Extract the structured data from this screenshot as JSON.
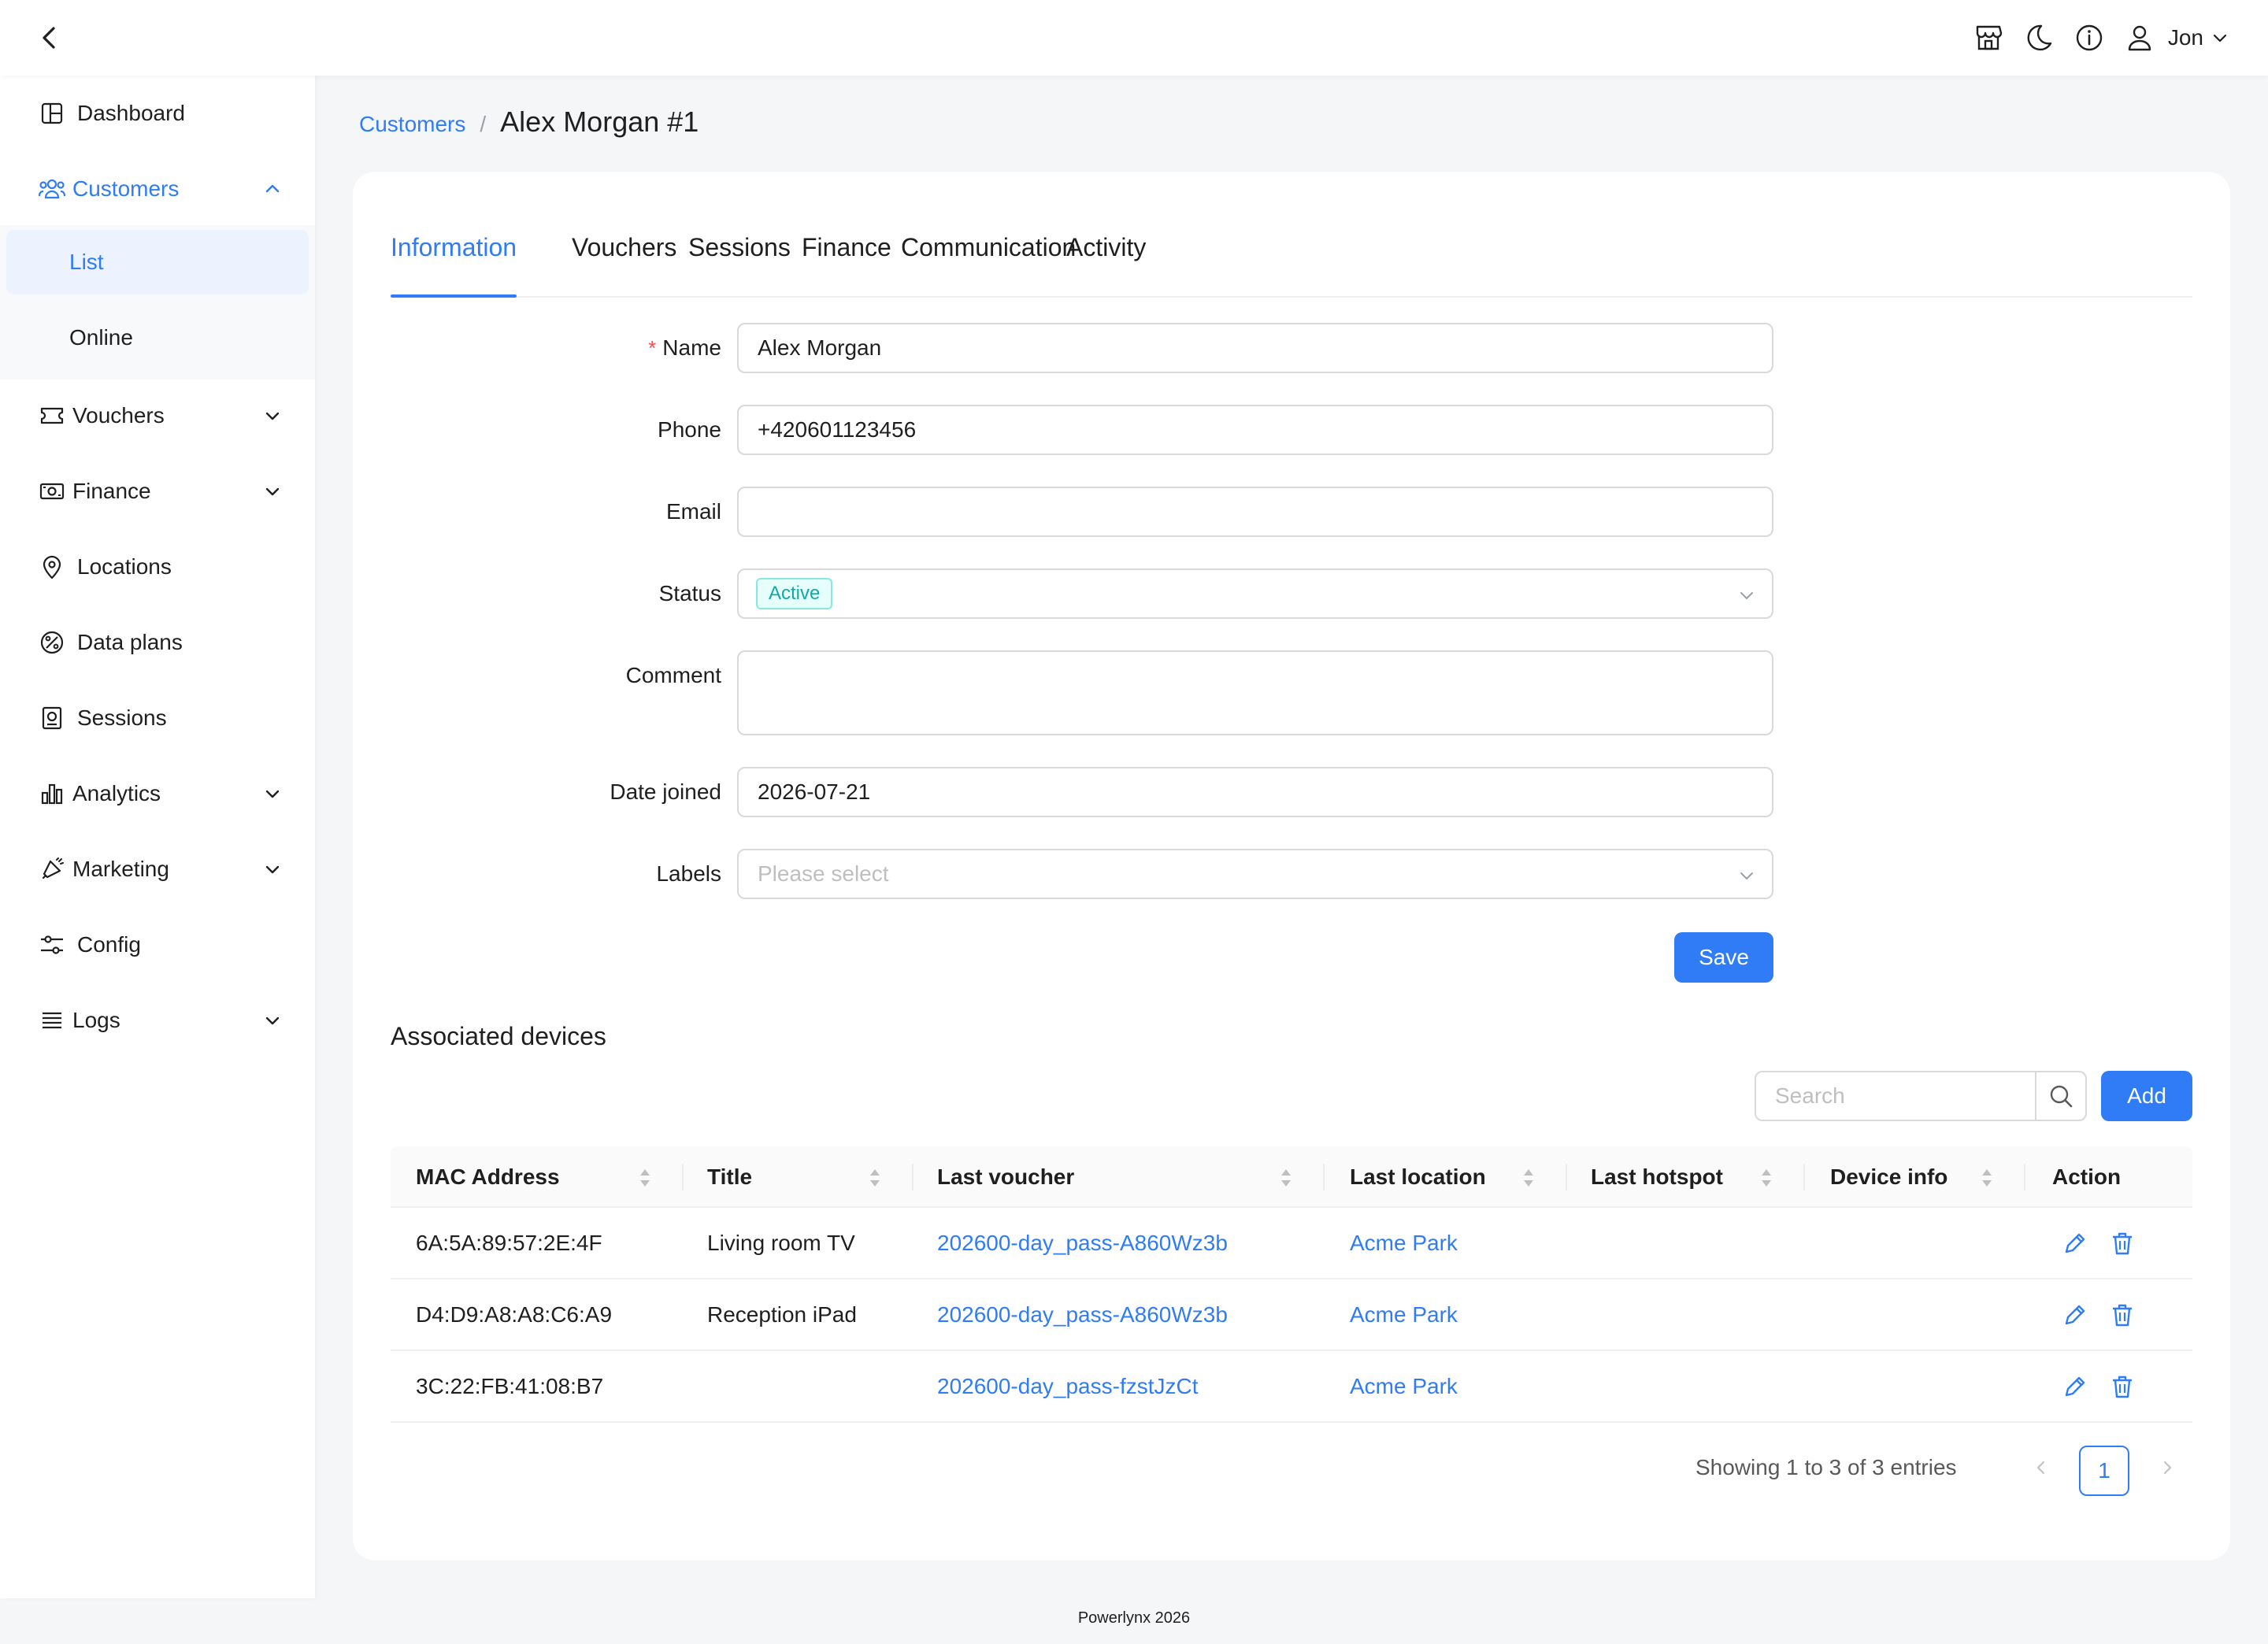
{
  "header": {
    "user_name": "Jon",
    "icons": [
      "back-icon",
      "store-icon",
      "moon-icon",
      "info-icon",
      "user-icon",
      "chevron-down-icon"
    ]
  },
  "sidebar": {
    "items": [
      {
        "label": "Dashboard",
        "icon": "dashboard-icon"
      },
      {
        "label": "Customers",
        "icon": "customers-icon",
        "expanded": true
      },
      {
        "label": "Vouchers",
        "icon": "ticket-icon"
      },
      {
        "label": "Finance",
        "icon": "money-icon"
      },
      {
        "label": "Locations",
        "icon": "location-pin-icon"
      },
      {
        "label": "Data plans",
        "icon": "data-plans-icon"
      },
      {
        "label": "Sessions",
        "icon": "sessions-icon"
      },
      {
        "label": "Analytics",
        "icon": "bar-chart-icon"
      },
      {
        "label": "Marketing",
        "icon": "megaphone-icon"
      },
      {
        "label": "Config",
        "icon": "sliders-icon"
      },
      {
        "label": "Logs",
        "icon": "list-icon"
      }
    ],
    "customers_sub": [
      {
        "label": "List",
        "active": true
      },
      {
        "label": "Online",
        "active": false
      }
    ]
  },
  "breadcrumb": {
    "parent": "Customers",
    "separator": "/",
    "current": "Alex Morgan #1"
  },
  "tabs": [
    {
      "label": "Information",
      "active": true
    },
    {
      "label": "Vouchers"
    },
    {
      "label": "Sessions"
    },
    {
      "label": "Finance"
    },
    {
      "label": "Communication"
    },
    {
      "label": "Activity"
    }
  ],
  "form": {
    "name_label": "Name",
    "name_value": "Alex Morgan",
    "phone_label": "Phone",
    "phone_value": "+420601123456",
    "email_label": "Email",
    "email_value": "",
    "status_label": "Status",
    "status_value": "Active",
    "comment_label": "Comment",
    "comment_value": "",
    "date_label": "Date joined",
    "date_value": "2026-07-21",
    "labels_label": "Labels",
    "labels_placeholder": "Please select",
    "save_label": "Save"
  },
  "devices": {
    "title": "Associated devices",
    "search_placeholder": "Search",
    "add_label": "Add",
    "columns": [
      "MAC Address",
      "Title",
      "Last voucher",
      "Last location",
      "Last hotspot",
      "Device info",
      "Action"
    ],
    "rows": [
      {
        "mac": "6A:5A:89:57:2E:4F",
        "title": "Living room TV",
        "voucher": "202600-day_pass-A860Wz3b",
        "location": "Acme Park",
        "hotspot": "",
        "device_info": ""
      },
      {
        "mac": "D4:D9:A8:A8:C6:A9",
        "title": "Reception iPad",
        "voucher": "202600-day_pass-A860Wz3b",
        "location": "Acme Park",
        "hotspot": "",
        "device_info": ""
      },
      {
        "mac": "3C:22:FB:41:08:B7",
        "title": "",
        "voucher": "202600-day_pass-fzstJzCt",
        "location": "Acme Park",
        "hotspot": "",
        "device_info": ""
      }
    ],
    "pagination_info": "Showing 1 to 3 of 3 entries",
    "current_page": "1"
  },
  "footer": "Powerlynx 2026",
  "colors": {
    "accent": "#2f7cf6",
    "active_tag": "#13a8a8",
    "required": "#ff4d4f",
    "background": "#f5f6f8"
  }
}
